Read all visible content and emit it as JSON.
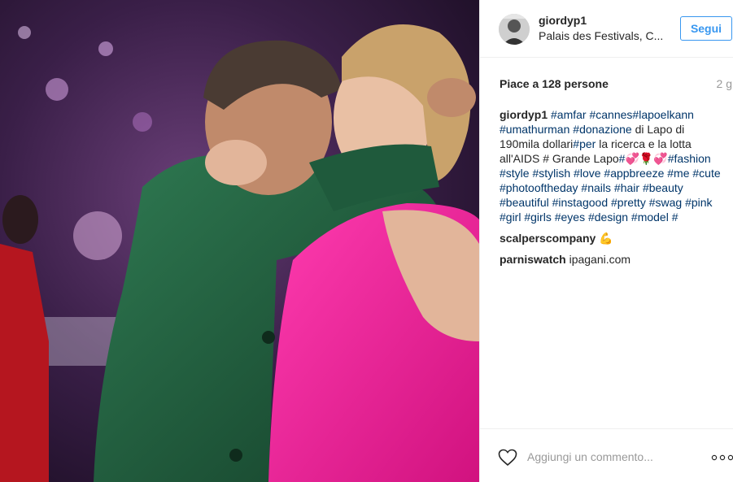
{
  "post": {
    "username": "giordyp1",
    "location": "Palais des Festivals, C...",
    "follow_label": "Segui",
    "likes": "Piace a 128 persone",
    "time": "2 g",
    "caption_segments": [
      {
        "text": "giordyp1",
        "kind": "user"
      },
      {
        "text": " ",
        "kind": "text"
      },
      {
        "text": "#amfar",
        "kind": "tag"
      },
      {
        "text": " ",
        "kind": "text"
      },
      {
        "text": "#cannes",
        "kind": "tag"
      },
      {
        "text": "#lapoelkann",
        "kind": "tag"
      },
      {
        "text": " ",
        "kind": "text"
      },
      {
        "text": "#umathurman",
        "kind": "tag"
      },
      {
        "text": " ",
        "kind": "text"
      },
      {
        "text": "#donazione",
        "kind": "tag"
      },
      {
        "text": " di Lapo di 190mila dollari",
        "kind": "text"
      },
      {
        "text": "#per",
        "kind": "tag"
      },
      {
        "text": " la ricerca e la lotta all'AIDS # Grande Lapo",
        "kind": "text"
      },
      {
        "text": "#💞🌹💞",
        "kind": "tag"
      },
      {
        "text": "#fashion",
        "kind": "tag"
      },
      {
        "text": " ",
        "kind": "text"
      },
      {
        "text": "#style",
        "kind": "tag"
      },
      {
        "text": " ",
        "kind": "text"
      },
      {
        "text": "#stylish",
        "kind": "tag"
      },
      {
        "text": " ",
        "kind": "text"
      },
      {
        "text": "#love",
        "kind": "tag"
      },
      {
        "text": " ",
        "kind": "text"
      },
      {
        "text": "#appbreeze",
        "kind": "tag"
      },
      {
        "text": " ",
        "kind": "text"
      },
      {
        "text": "#me",
        "kind": "tag"
      },
      {
        "text": " ",
        "kind": "text"
      },
      {
        "text": "#cute",
        "kind": "tag"
      },
      {
        "text": " ",
        "kind": "text"
      },
      {
        "text": "#photooftheday",
        "kind": "tag"
      },
      {
        "text": " ",
        "kind": "text"
      },
      {
        "text": "#nails",
        "kind": "tag"
      },
      {
        "text": " ",
        "kind": "text"
      },
      {
        "text": "#hair",
        "kind": "tag"
      },
      {
        "text": " ",
        "kind": "text"
      },
      {
        "text": "#beauty",
        "kind": "tag"
      },
      {
        "text": " ",
        "kind": "text"
      },
      {
        "text": "#beautiful",
        "kind": "tag"
      },
      {
        "text": " ",
        "kind": "text"
      },
      {
        "text": "#instagood",
        "kind": "tag"
      },
      {
        "text": " ",
        "kind": "text"
      },
      {
        "text": "#pretty",
        "kind": "tag"
      },
      {
        "text": " ",
        "kind": "text"
      },
      {
        "text": "#swag",
        "kind": "tag"
      },
      {
        "text": " ",
        "kind": "text"
      },
      {
        "text": "#pink",
        "kind": "tag"
      },
      {
        "text": " ",
        "kind": "text"
      },
      {
        "text": "#girl",
        "kind": "tag"
      },
      {
        "text": " ",
        "kind": "text"
      },
      {
        "text": "#girls",
        "kind": "tag"
      },
      {
        "text": " ",
        "kind": "text"
      },
      {
        "text": "#eyes",
        "kind": "tag"
      },
      {
        "text": " ",
        "kind": "text"
      },
      {
        "text": "#design",
        "kind": "tag"
      },
      {
        "text": " ",
        "kind": "text"
      },
      {
        "text": "#model",
        "kind": "tag"
      },
      {
        "text": " ",
        "kind": "text"
      },
      {
        "text": "#",
        "kind": "tag"
      }
    ],
    "comments": [
      {
        "user": "scalperscompany",
        "text": " 💪"
      },
      {
        "user": "parniswatch",
        "text": " ipagani.com"
      }
    ],
    "comment_placeholder": "Aggiungi un commento...",
    "more_options": "..."
  },
  "icons": {
    "like": "heart-icon",
    "options": "more-options-icon"
  },
  "colors": {
    "accent": "#3897f0",
    "hashtag": "#003569",
    "text": "#262626",
    "muted": "#999999",
    "jacket": "#1f5a3c",
    "dress": "#ee1e9a"
  }
}
